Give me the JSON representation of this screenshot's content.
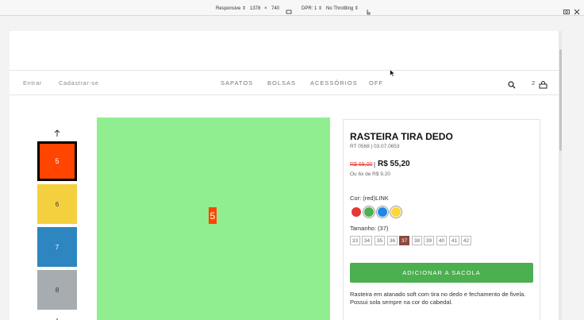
{
  "devtools": {
    "device": "Responsive ⇕",
    "width": "1378",
    "times": "×",
    "height": "740",
    "dpr": "DPR: 1 ⇕",
    "throttle": "No Throttling ⇕"
  },
  "header": {
    "login": "Entrar",
    "register": "Cadastrar-se",
    "nav": [
      "SAPATOS",
      "BOLSAS",
      "ACESSÓRIOS",
      "OFF"
    ],
    "cart_count": "2"
  },
  "gallery": {
    "thumbs": [
      {
        "label": "5",
        "color": "#ff4500",
        "selected": true
      },
      {
        "label": "6",
        "color": "#f4d03f",
        "selected": false
      },
      {
        "label": "7",
        "color": "#2e86c1",
        "selected": false
      },
      {
        "label": "8",
        "color": "#a6acaf",
        "selected": false
      }
    ],
    "main_label": "5",
    "main_color": "#90ee90"
  },
  "product": {
    "title": "RASTEIRA TIRA DEDO",
    "code": "RT 0568 | 03.07.0653",
    "old_price": "R$ 69,00",
    "separator": "|",
    "price": "R$ 55,20",
    "installments": "Ou 6x de R$ 9,20",
    "color_label": "Cor: (red)LINK",
    "colors": [
      "#e53935",
      "#4caf50",
      "#1e88e5",
      "#fdd835"
    ],
    "size_label": "Tamanho: (37)",
    "sizes": [
      "33",
      "34",
      "35",
      "36",
      "37",
      "38",
      "39",
      "40",
      "41",
      "42"
    ],
    "selected_size": "37",
    "add_button": "ADICIONAR A SACOLA",
    "description": "Rasteira em atanado soft com tira no dedo e fechamento de fivela. Possui sola sempre na cor do cabedal."
  }
}
